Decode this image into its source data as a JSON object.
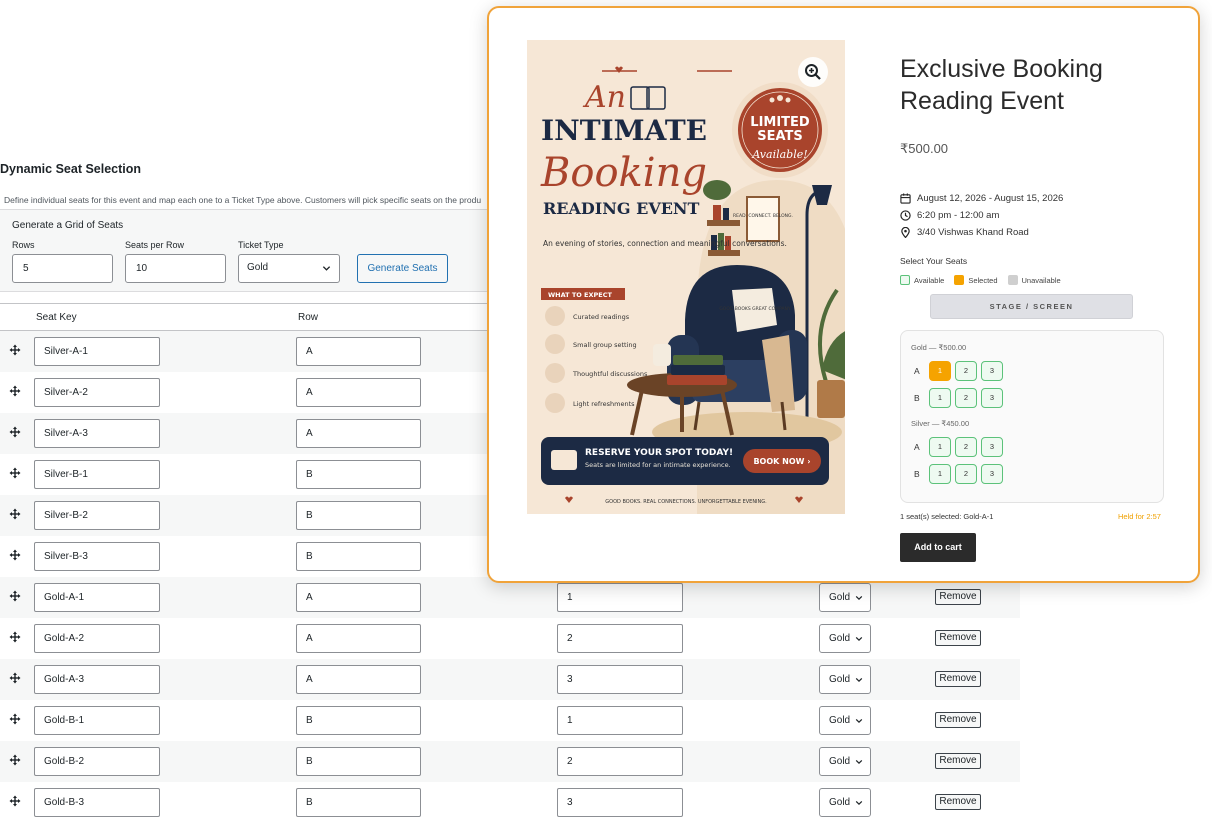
{
  "admin": {
    "title": "Dynamic Seat Selection",
    "description": "Define individual seats for this event and map each one to a Ticket Type above. Customers will pick specific seats on the produ",
    "generator": {
      "title": "Generate a Grid of Seats",
      "rows_label": "Rows",
      "rows_value": "5",
      "seats_per_row_label": "Seats per Row",
      "seats_per_row_value": "10",
      "ticket_type_label": "Ticket Type",
      "ticket_type_value": "Gold",
      "generate_button": "Generate Seats"
    },
    "table": {
      "headers": {
        "seat_key": "Seat Key",
        "row": "Row"
      },
      "remove_label": "Remove",
      "rows": [
        {
          "key": "Silver-A-1",
          "row": "A",
          "num": "",
          "type": ""
        },
        {
          "key": "Silver-A-2",
          "row": "A",
          "num": "",
          "type": ""
        },
        {
          "key": "Silver-A-3",
          "row": "A",
          "num": "",
          "type": ""
        },
        {
          "key": "Silver-B-1",
          "row": "B",
          "num": "",
          "type": ""
        },
        {
          "key": "Silver-B-2",
          "row": "B",
          "num": "",
          "type": ""
        },
        {
          "key": "Silver-B-3",
          "row": "B",
          "num": "",
          "type": ""
        },
        {
          "key": "Gold-A-1",
          "row": "A",
          "num": "1",
          "type": "Gold"
        },
        {
          "key": "Gold-A-2",
          "row": "A",
          "num": "2",
          "type": "Gold"
        },
        {
          "key": "Gold-A-3",
          "row": "A",
          "num": "3",
          "type": "Gold"
        },
        {
          "key": "Gold-B-1",
          "row": "B",
          "num": "1",
          "type": "Gold"
        },
        {
          "key": "Gold-B-2",
          "row": "B",
          "num": "2",
          "type": "Gold"
        },
        {
          "key": "Gold-B-3",
          "row": "B",
          "num": "3",
          "type": "Gold"
        }
      ]
    }
  },
  "product": {
    "title_line1": "Exclusive Booking",
    "title_line2": "Reading Event",
    "price": "₹500.00",
    "date": "August 12, 2026 - August 15, 2026",
    "time": "6:20 pm - 12:00 am",
    "location": "3/40 Vishwas Khand Road",
    "select_label": "Select Your Seats",
    "legend": {
      "available": "Available",
      "selected": "Selected",
      "unavailable": "Unavailable"
    },
    "screen_label": "STAGE / SCREEN",
    "groups": [
      {
        "label": "Gold — ₹500.00",
        "rows": [
          {
            "row": "A",
            "seats": [
              {
                "n": "1",
                "selected": true
              },
              {
                "n": "2",
                "selected": false
              },
              {
                "n": "3",
                "selected": false
              }
            ]
          },
          {
            "row": "B",
            "seats": [
              {
                "n": "1",
                "selected": false
              },
              {
                "n": "2",
                "selected": false
              },
              {
                "n": "3",
                "selected": false
              }
            ]
          }
        ]
      },
      {
        "label": "Silver — ₹450.00",
        "rows": [
          {
            "row": "A",
            "seats": [
              {
                "n": "1",
                "selected": false
              },
              {
                "n": "2",
                "selected": false
              },
              {
                "n": "3",
                "selected": false
              }
            ]
          },
          {
            "row": "B",
            "seats": [
              {
                "n": "1",
                "selected": false
              },
              {
                "n": "2",
                "selected": false
              },
              {
                "n": "3",
                "selected": false
              }
            ]
          }
        ]
      }
    ],
    "summary": "1 seat(s) selected: Gold-A-1",
    "held": "Held for 2:57",
    "add_to_cart": "Add to cart"
  },
  "poster": {
    "line_an": "An",
    "line_intimate": "INTIMATE",
    "line_booking": "Booking",
    "line_reading": "READING EVENT",
    "badge_line1": "LIMITED",
    "badge_line2": "SEATS",
    "badge_line3": "Available!",
    "sign_text": "READ. CONNECT. BELONG.",
    "pillow_text": "GOOD BOOKS GREAT COMPANY",
    "tagline": "An evening of stories, connection and meaningful conversations.",
    "expect_label": "WHAT TO EXPECT",
    "expect_items": [
      "Curated readings",
      "Small group setting",
      "Thoughtful discussions",
      "Light refreshments"
    ],
    "cta_title": "RESERVE YOUR SPOT TODAY!",
    "cta_sub": "Seats are limited for an intimate experience.",
    "cta_button": "BOOK NOW ›",
    "footer": "GOOD BOOKS. REAL CONNECTIONS. UNFORGETTABLE EVENING.",
    "colors": {
      "bg": "#f6e7d6",
      "rust": "#a9442c",
      "navy": "#1c2a44"
    }
  },
  "colors": {
    "accent_orange": "#f0a33a",
    "seat_selected": "#f5a300",
    "seat_available_border": "#5cc27a",
    "admin_blue": "#2271b1"
  }
}
